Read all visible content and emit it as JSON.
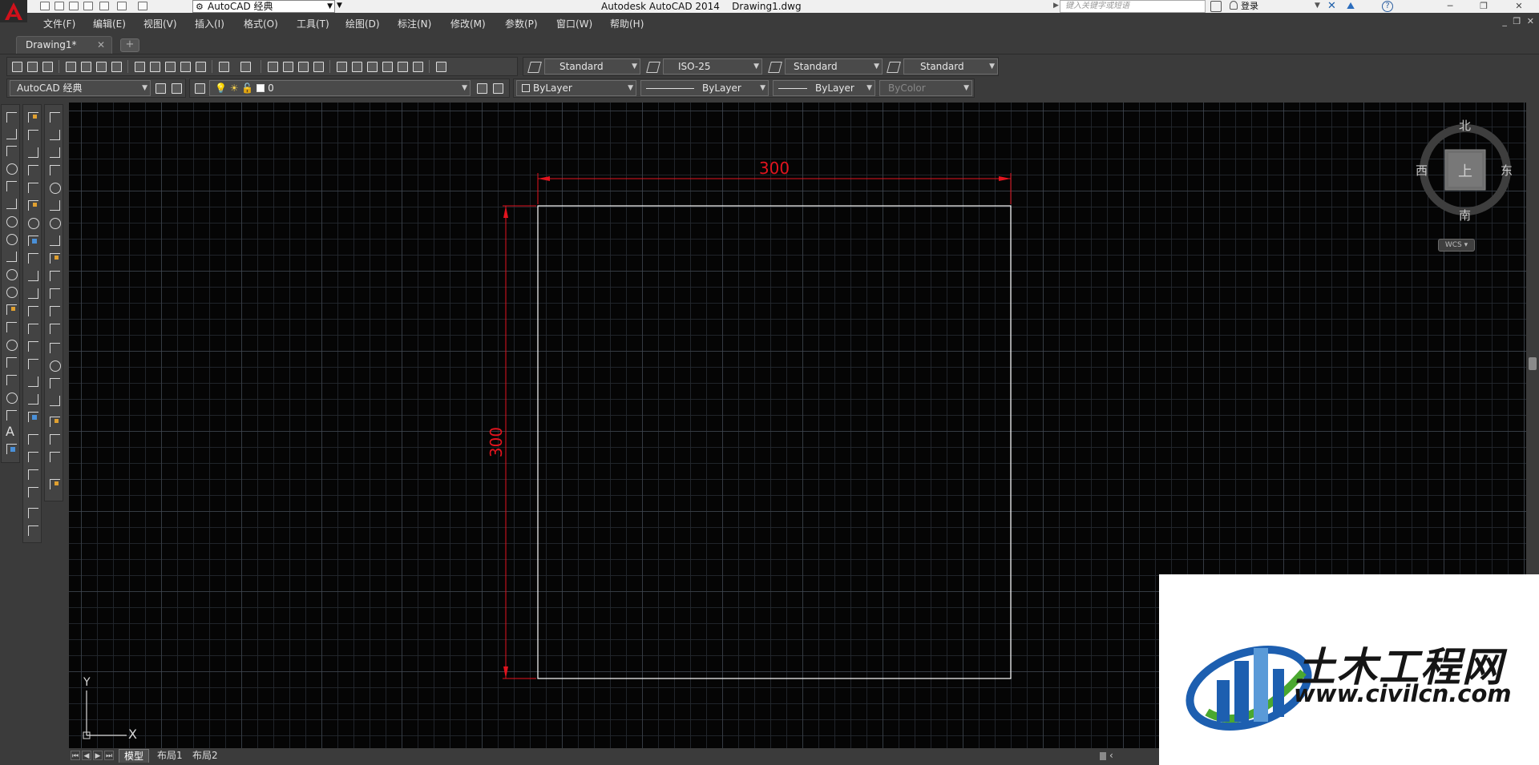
{
  "titlebar": {
    "title": "Autodesk AutoCAD 2014    Drawing1.dwg",
    "workspace": "AutoCAD 经典",
    "search_placeholder": "键入关键字或短语",
    "login_label": "登录"
  },
  "menu": {
    "items": [
      "文件(F)",
      "编辑(E)",
      "视图(V)",
      "插入(I)",
      "格式(O)",
      "工具(T)",
      "绘图(D)",
      "标注(N)",
      "修改(M)",
      "参数(P)",
      "窗口(W)",
      "帮助(H)"
    ]
  },
  "tabs": {
    "active": "Drawing1*"
  },
  "styles_toolbar": {
    "text_style": "Standard",
    "dim_style": "ISO-25",
    "table_style": "Standard",
    "multileader_style": "Standard"
  },
  "workspace_toolbar": {
    "workspace": "AutoCAD 经典"
  },
  "layers_toolbar": {
    "current_layer": "0"
  },
  "properties_toolbar": {
    "color": "ByLayer",
    "linetype": "ByLayer",
    "lineweight": "ByLayer",
    "plot_style": "ByColor"
  },
  "viewcube": {
    "north": "北",
    "south": "南",
    "east": "东",
    "west": "西",
    "face": "上",
    "wcs": "WCS"
  },
  "drawing": {
    "horizontal_dimension": "300",
    "vertical_dimension": "300",
    "dimension_color": "#e2141e",
    "geometry_color": "#ffffff"
  },
  "ucs": {
    "x_label": "X",
    "y_label": "Y"
  },
  "layout_tabs": {
    "model": "模型",
    "layout1": "布局1",
    "layout2": "布局2"
  },
  "watermark": {
    "title": "土木工程网",
    "url": "www.civilcn.com"
  }
}
